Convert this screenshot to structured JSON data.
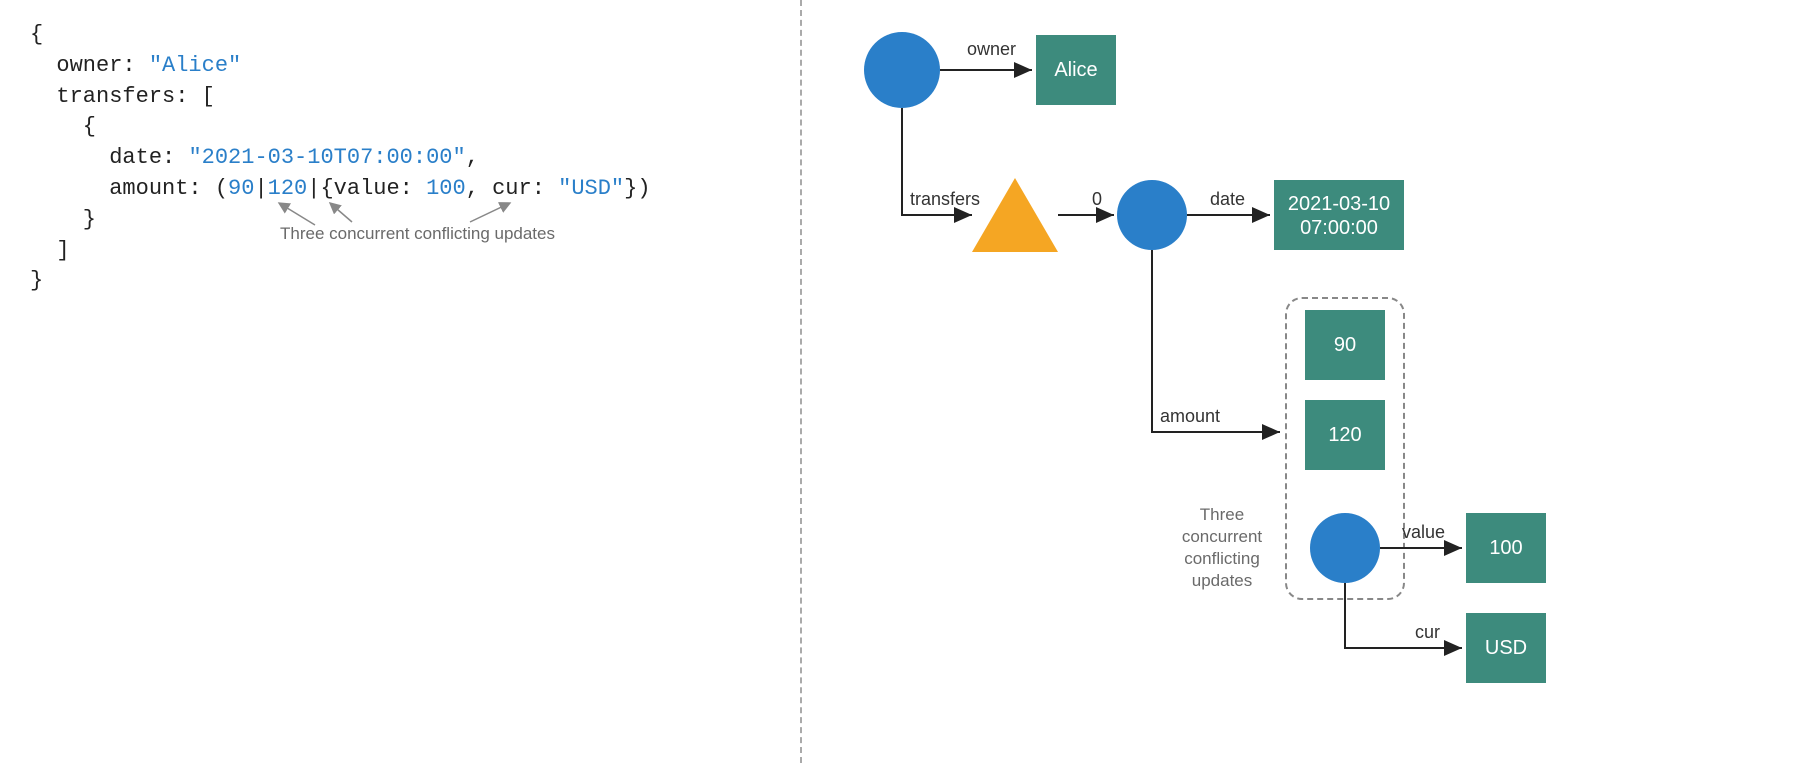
{
  "code": {
    "l1": "{",
    "l2_prefix": "  owner: ",
    "l2_val": "\"Alice\"",
    "l3": "  transfers: [",
    "l4": "    {",
    "l5_prefix": "      date: ",
    "l5_val": "\"2021-03-10T07:00:00\"",
    "l5_suffix": ",",
    "l6_prefix": "      amount: (",
    "l6_v1": "90",
    "l6_sep1": "|",
    "l6_v2": "120",
    "l6_sep2": "|{value: ",
    "l6_v3": "100",
    "l6_sep3": ", cur: ",
    "l6_v4": "\"USD\"",
    "l6_suffix": "})",
    "l7": "    }",
    "l8": "  ]",
    "l9": "}"
  },
  "annotation_left": "Three concurrent conflicting updates",
  "diagram": {
    "owner_label": "owner",
    "owner_value": "Alice",
    "transfers_label": "transfers",
    "index_label": "0",
    "date_label": "date",
    "date_value_l1": "2021-03-10",
    "date_value_l2": "07:00:00",
    "amount_label": "amount",
    "amount_v1": "90",
    "amount_v2": "120",
    "value_label": "value",
    "value_val": "100",
    "cur_label": "cur",
    "cur_val": "USD",
    "annotation_l1": "Three",
    "annotation_l2": "concurrent",
    "annotation_l3": "conflicting",
    "annotation_l4": "updates"
  }
}
